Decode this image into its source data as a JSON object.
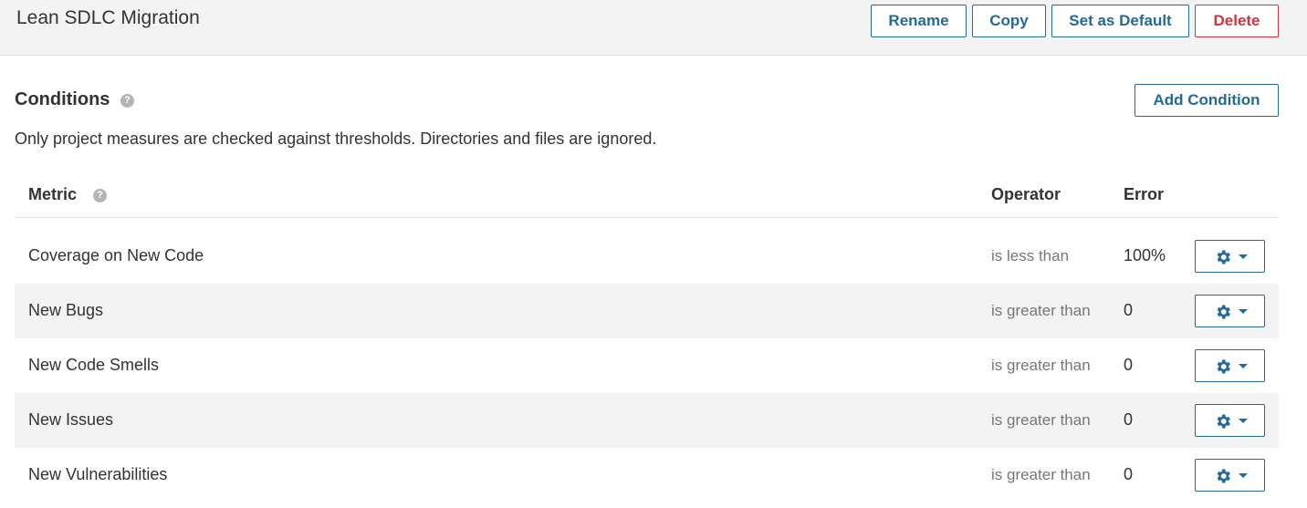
{
  "header": {
    "title": "Lean SDLC Migration",
    "buttons": {
      "rename": "Rename",
      "copy": "Copy",
      "set_default": "Set as Default",
      "delete": "Delete"
    }
  },
  "conditions": {
    "title": "Conditions",
    "help_glyph": "?",
    "description": "Only project measures are checked against thresholds. Directories and files are ignored.",
    "add_button": "Add Condition"
  },
  "table": {
    "columns": {
      "metric": "Metric",
      "operator": "Operator",
      "error": "Error"
    },
    "rows": [
      {
        "metric": "Coverage on New Code",
        "operator": "is less than",
        "error": "100%"
      },
      {
        "metric": "New Bugs",
        "operator": "is greater than",
        "error": "0"
      },
      {
        "metric": "New Code Smells",
        "operator": "is greater than",
        "error": "0"
      },
      {
        "metric": "New Issues",
        "operator": "is greater than",
        "error": "0"
      },
      {
        "metric": "New Vulnerabilities",
        "operator": "is greater than",
        "error": "0"
      }
    ]
  },
  "colors": {
    "accent": "#236a97",
    "danger": "#d4333f",
    "row_alt": "#f3f3f3"
  },
  "icons": {
    "help": "question-circle-icon",
    "row_actions": "gear-icon",
    "dropdown": "caret-down-icon"
  }
}
